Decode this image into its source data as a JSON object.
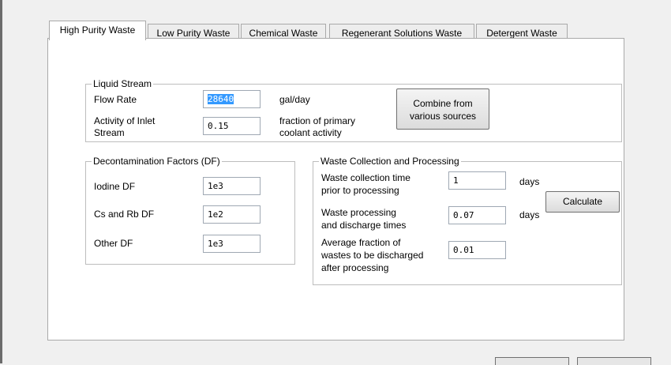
{
  "tabs": [
    {
      "label": "High Purity Waste",
      "active": true
    },
    {
      "label": "Low Purity Waste"
    },
    {
      "label": "Chemical Waste"
    },
    {
      "label": "Regenerant Solutions Waste"
    },
    {
      "label": "Detergent Waste"
    }
  ],
  "liquid_stream": {
    "legend": "Liquid Stream",
    "flow_rate_label": "Flow Rate",
    "flow_rate_value": "28640",
    "flow_rate_unit": "gal/day",
    "activity_label_line1": "Activity of Inlet",
    "activity_label_line2": "Stream",
    "activity_value": "0.15",
    "activity_unit_line1": "fraction of primary",
    "activity_unit_line2": "coolant activity",
    "combine_button_line1": "Combine from",
    "combine_button_line2": "various sources"
  },
  "decontamination": {
    "legend": "Decontamination Factors (DF)",
    "iodine_label": "Iodine DF",
    "iodine_value": "1e3",
    "cs_rb_label": "Cs and Rb DF",
    "cs_rb_value": "1e2",
    "other_label": "Other  DF",
    "other_value": "1e3"
  },
  "waste_collection": {
    "legend": "Waste Collection and Processing",
    "collection_time_line1": "Waste collection time",
    "collection_time_line2": "prior to processing",
    "collection_time_value": "1",
    "collection_time_unit": "days",
    "processing_line1": "Waste processing",
    "processing_line2": "and discharge times",
    "processing_value": "0.07",
    "processing_unit": "days",
    "fraction_line1": "Average fraction of",
    "fraction_line2": "wastes to be discharged",
    "fraction_line3": "after processing",
    "fraction_value": "0.01",
    "calculate_button": "Calculate"
  }
}
